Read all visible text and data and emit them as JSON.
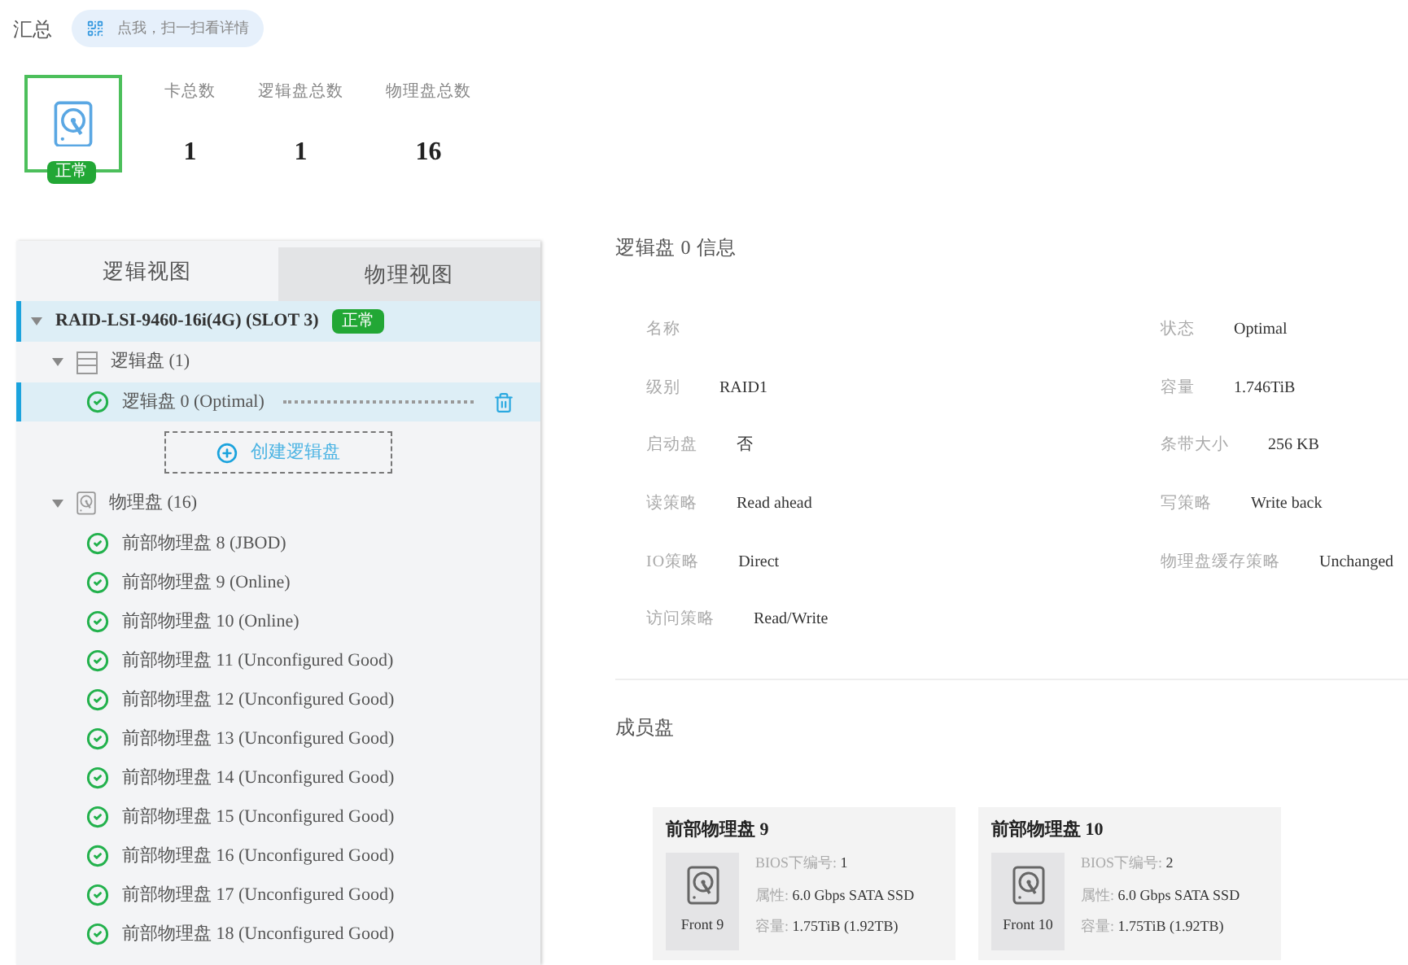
{
  "header": {
    "title": "汇总",
    "scan_hint": "点我，扫一扫看详情"
  },
  "summary": {
    "status": "正常",
    "stats": [
      {
        "label": "卡总数",
        "value": "1"
      },
      {
        "label": "逻辑盘总数",
        "value": "1"
      },
      {
        "label": "物理盘总数",
        "value": "16"
      }
    ]
  },
  "tabs": [
    {
      "label": "逻辑视图",
      "selected": true
    },
    {
      "label": "物理视图",
      "selected": false
    }
  ],
  "tree": {
    "label": "RAID-LSI-9460-16i(4G) (SLOT 3)",
    "badge": "正常",
    "expanded": true,
    "selected": true,
    "children": [
      {
        "kind": "logical_group",
        "label": "逻辑盘 (1)",
        "expanded": true,
        "action": "创建逻辑盘",
        "children": [
          {
            "label": "逻辑盘 0 (Optimal)",
            "selected": true
          }
        ]
      },
      {
        "kind": "physical_group",
        "label": "物理盘 (16)",
        "expanded": true,
        "children": [
          {
            "label": "前部物理盘 8 (JBOD)",
            "selected": false
          },
          {
            "label": "前部物理盘 9 (Online)",
            "selected": false
          },
          {
            "label": "前部物理盘 10 (Online)",
            "selected": false
          },
          {
            "label": "前部物理盘 11 (Unconfigured Good)",
            "selected": false
          },
          {
            "label": "前部物理盘 12 (Unconfigured Good)",
            "selected": false
          },
          {
            "label": "前部物理盘 13 (Unconfigured Good)",
            "selected": false
          },
          {
            "label": "前部物理盘 14 (Unconfigured Good)",
            "selected": false
          },
          {
            "label": "前部物理盘 15 (Unconfigured Good)",
            "selected": false
          },
          {
            "label": "前部物理盘 16 (Unconfigured Good)",
            "selected": false
          },
          {
            "label": "前部物理盘 17 (Unconfigured Good)",
            "selected": false
          },
          {
            "label": "前部物理盘 18 (Unconfigured Good)",
            "selected": false
          }
        ]
      }
    ]
  },
  "detail": {
    "title": "逻辑盘 0 信息",
    "fields": [
      {
        "label": "名称"
      },
      {
        "label": "状态",
        "value": "Optimal"
      },
      {
        "label": "级别",
        "value": "RAID1"
      },
      {
        "label": "容量",
        "value": "1.746TiB"
      },
      {
        "label": "启动盘",
        "value": "否"
      },
      {
        "label": "条带大小",
        "value": "256 KB"
      },
      {
        "label": "读策略",
        "value": "Read ahead"
      },
      {
        "label": "写策略",
        "value": "Write back"
      },
      {
        "label": "IO策略",
        "value": "Direct"
      },
      {
        "label": "物理盘缓存策略",
        "value": "Unchanged"
      },
      {
        "label": "访问策略",
        "value": "Read/Write"
      }
    ],
    "members_title": "成员盘",
    "members": [
      {
        "title": "前部物理盘 9",
        "slot": "Front 9",
        "bios_label": "BIOS下编号:",
        "bios": "1",
        "attr_label": "属性:",
        "attr": "6.0 Gbps SATA SSD",
        "cap_label": "容量:",
        "capacity": "1.75TiB (1.92TB)"
      },
      {
        "title": "前部物理盘 10",
        "slot": "Front 10",
        "bios_label": "BIOS下编号:",
        "bios": "2",
        "attr_label": "属性:",
        "attr": "6.0 Gbps SATA SSD",
        "cap_label": "容量:",
        "capacity": "1.75TiB (1.92TB)"
      }
    ]
  }
}
